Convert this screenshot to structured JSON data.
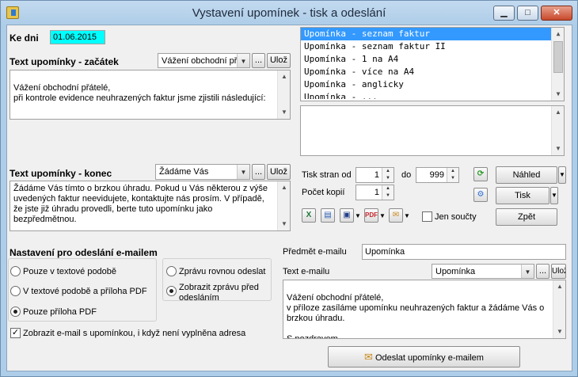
{
  "window": {
    "title": "Vystavení upomínek - tisk a odeslání"
  },
  "date": {
    "label": "Ke dni",
    "value": "01.06.2015"
  },
  "text_start": {
    "label": "Text upomínky - začátek",
    "combo_value": "Vážení obchodní př",
    "dots": "...",
    "save": "Ulož",
    "body": "Vážení obchodní přátelé,\npři kontrole evidence neuhrazených faktur jsme zjistili následující:"
  },
  "text_end": {
    "label": "Text upomínky - konec",
    "combo_value": "Žádáme Vás",
    "dots": "...",
    "save": "Ulož",
    "body": "Žádáme Vás tímto o  brzkou úhradu. Pokud u Vás některou z výše uvedených faktur neevidujete, kontaktujte nás prosím.  V případě, že jste již úhradu provedli, berte tuto upomínku jako bezpředmětnou."
  },
  "report_list": {
    "items": [
      "Upomínka - seznam faktur",
      "Upomínka - seznam faktur II",
      "Upomínka - 1 na A4",
      "Upomínka - více na A4",
      "Upomínka - anglicky",
      "Upomínka - ..."
    ],
    "selected": 0
  },
  "print": {
    "pages_from_label": "Tisk stran od",
    "pages_from": "1",
    "to_label": "do",
    "pages_to": "999",
    "copies_label": "Počet kopií",
    "copies": "1",
    "totals_only": "Jen součty",
    "preview": "Náhled",
    "print": "Tisk",
    "back": "Zpět"
  },
  "email_settings": {
    "title": "Nastavení pro odeslání e-mailem",
    "opt_text": "Pouze v textové podobě",
    "opt_text_pdf": "V textové podobě a příloha PDF",
    "opt_pdf": "Pouze příloha PDF",
    "opt_send_now": "Zprávu rovnou odeslat",
    "opt_show_before": "Zobrazit zprávu před odesláním",
    "show_even_without": "Zobrazit e-mail s upomínkou, i když není vyplněna adresa"
  },
  "email": {
    "subject_label": "Předmět e-mailu",
    "subject": "Upomínka",
    "text_label": "Text e-mailu",
    "combo_value": "Upomínka",
    "dots": "...",
    "save": "Ulož",
    "body": "Vážení obchodní přátelé,\nv příloze zasíláme upomínku neuhrazených faktur a žádáme Vás o brzkou úhradu.\n\nS pozdravem",
    "send_button": "Odeslat upomínky e-mailem"
  },
  "colors": {
    "title_bg": "#aecde8",
    "date_bg": "#00ffff",
    "list_selected": "#3399ff"
  }
}
